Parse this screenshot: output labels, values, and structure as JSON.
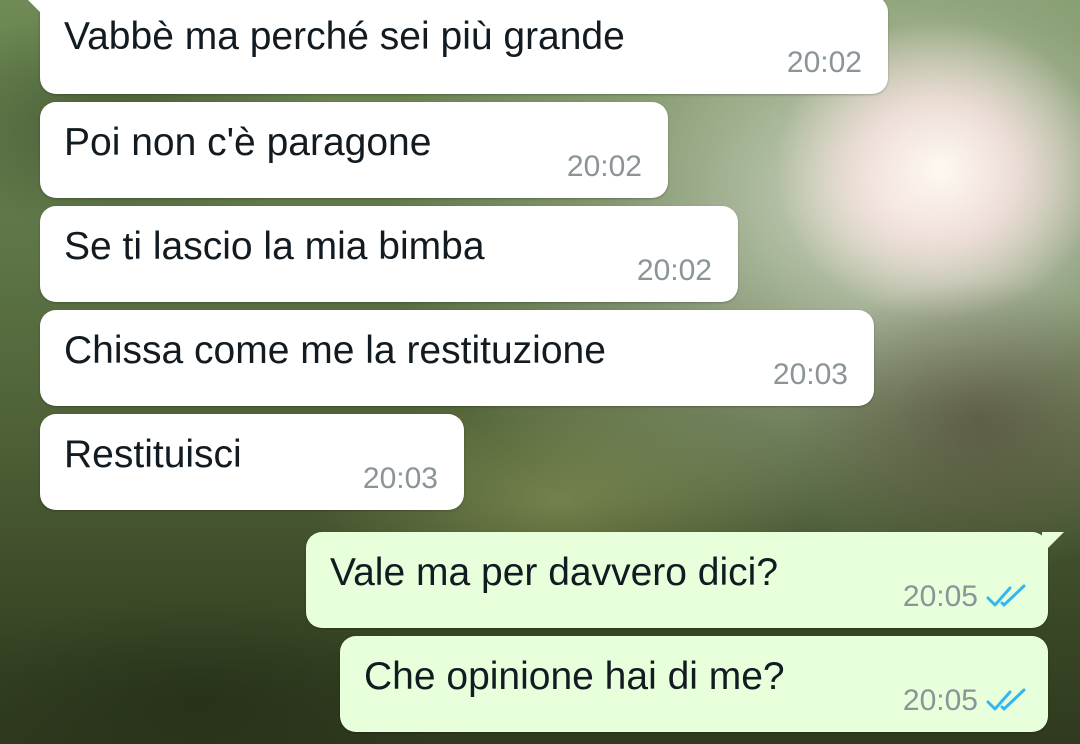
{
  "colors": {
    "incoming_bubble": "#ffffff",
    "outgoing_bubble": "#e7ffdb",
    "read_ticks": "#34b7f1",
    "timestamp": "#8a9499"
  },
  "messages": [
    {
      "direction": "incoming",
      "text": "Vabbè ma perché sei più grande",
      "time": "20:02"
    },
    {
      "direction": "incoming",
      "text": "Poi non c'è paragone",
      "time": "20:02"
    },
    {
      "direction": "incoming",
      "text": "Se ti lascio la mia bimba",
      "time": "20:02"
    },
    {
      "direction": "incoming",
      "text": "Chissa come me la restituzione",
      "time": "20:03"
    },
    {
      "direction": "incoming",
      "text": "Restituisci",
      "time": "20:03"
    },
    {
      "direction": "outgoing",
      "text": "Vale ma per davvero dici?",
      "time": "20:05",
      "status_icon": "double-check-read-icon"
    },
    {
      "direction": "outgoing",
      "text": "Che opinione hai di me?",
      "time": "20:05",
      "status_icon": "double-check-read-icon"
    }
  ]
}
